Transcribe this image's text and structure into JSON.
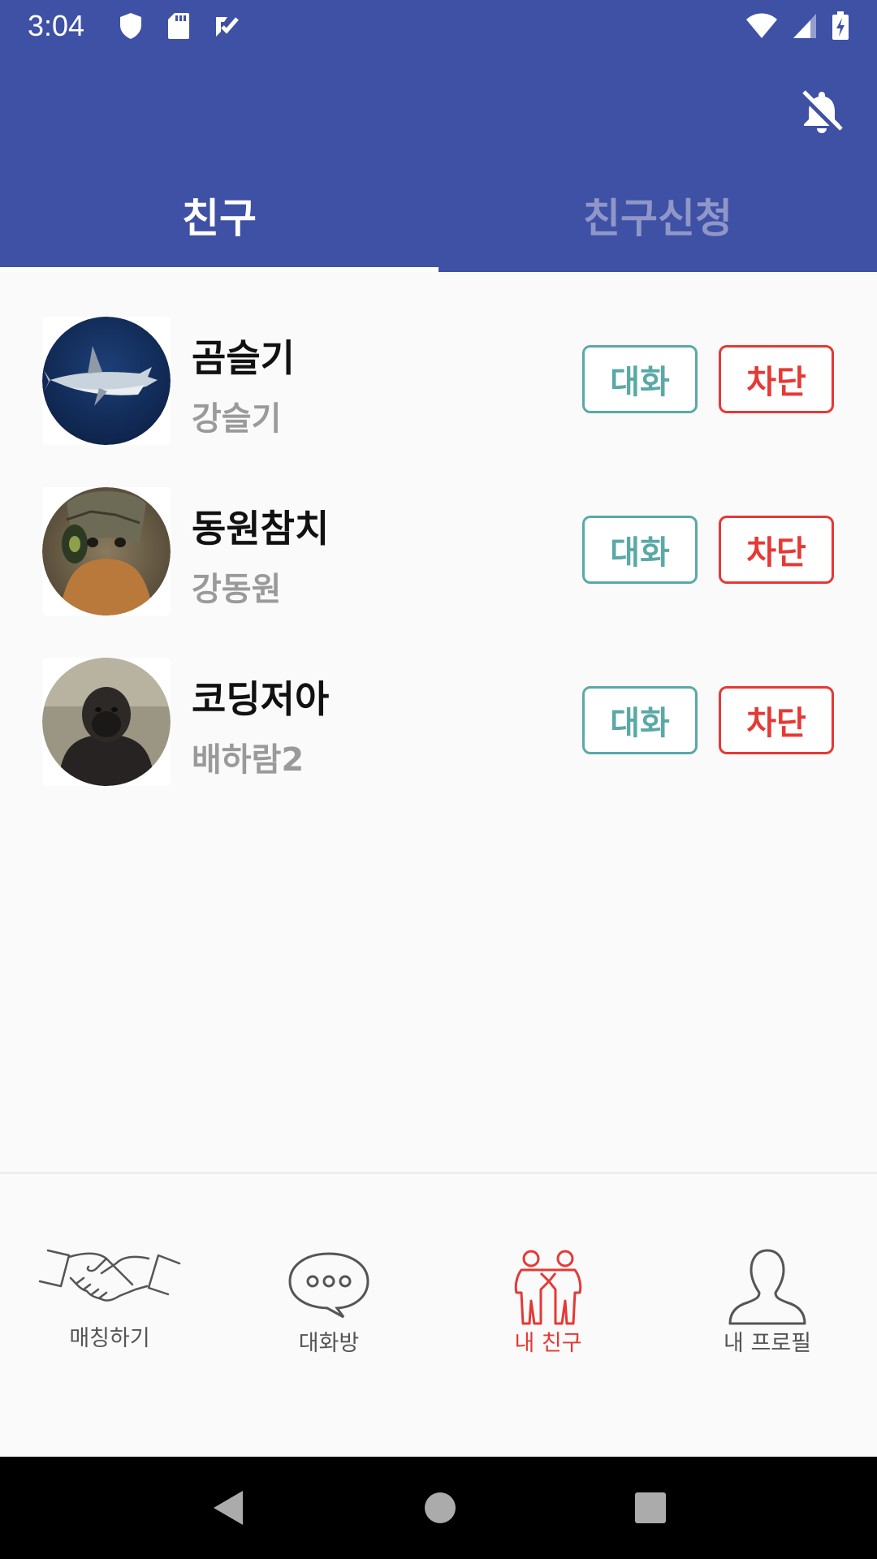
{
  "status_bar": {
    "time": "3:04"
  },
  "tabs": [
    {
      "label": "친구",
      "active": true
    },
    {
      "label": "친구신청",
      "active": false
    }
  ],
  "friends": [
    {
      "nickname": "곰슬기",
      "name": "강슬기",
      "chat_label": "대화",
      "block_label": "차단",
      "avatar": "shark-photo"
    },
    {
      "nickname": "동원참치",
      "name": "강동원",
      "chat_label": "대화",
      "block_label": "차단",
      "avatar": "turtle-photo"
    },
    {
      "nickname": "코딩저아",
      "name": "배하람2",
      "chat_label": "대화",
      "block_label": "차단",
      "avatar": "gorilla-photo"
    }
  ],
  "bottom_nav": [
    {
      "label": "매칭하기",
      "icon": "handshake-icon",
      "active": false
    },
    {
      "label": "대화방",
      "icon": "chat-bubble-icon",
      "active": false
    },
    {
      "label": "내 친구",
      "icon": "friends-icon",
      "active": true
    },
    {
      "label": "내 프로필",
      "icon": "profile-icon",
      "active": false
    }
  ],
  "colors": {
    "primary": "#3f51a5",
    "chat_accent": "#5aa9a7",
    "block_accent": "#e53935",
    "active_nav": "#e53935"
  }
}
